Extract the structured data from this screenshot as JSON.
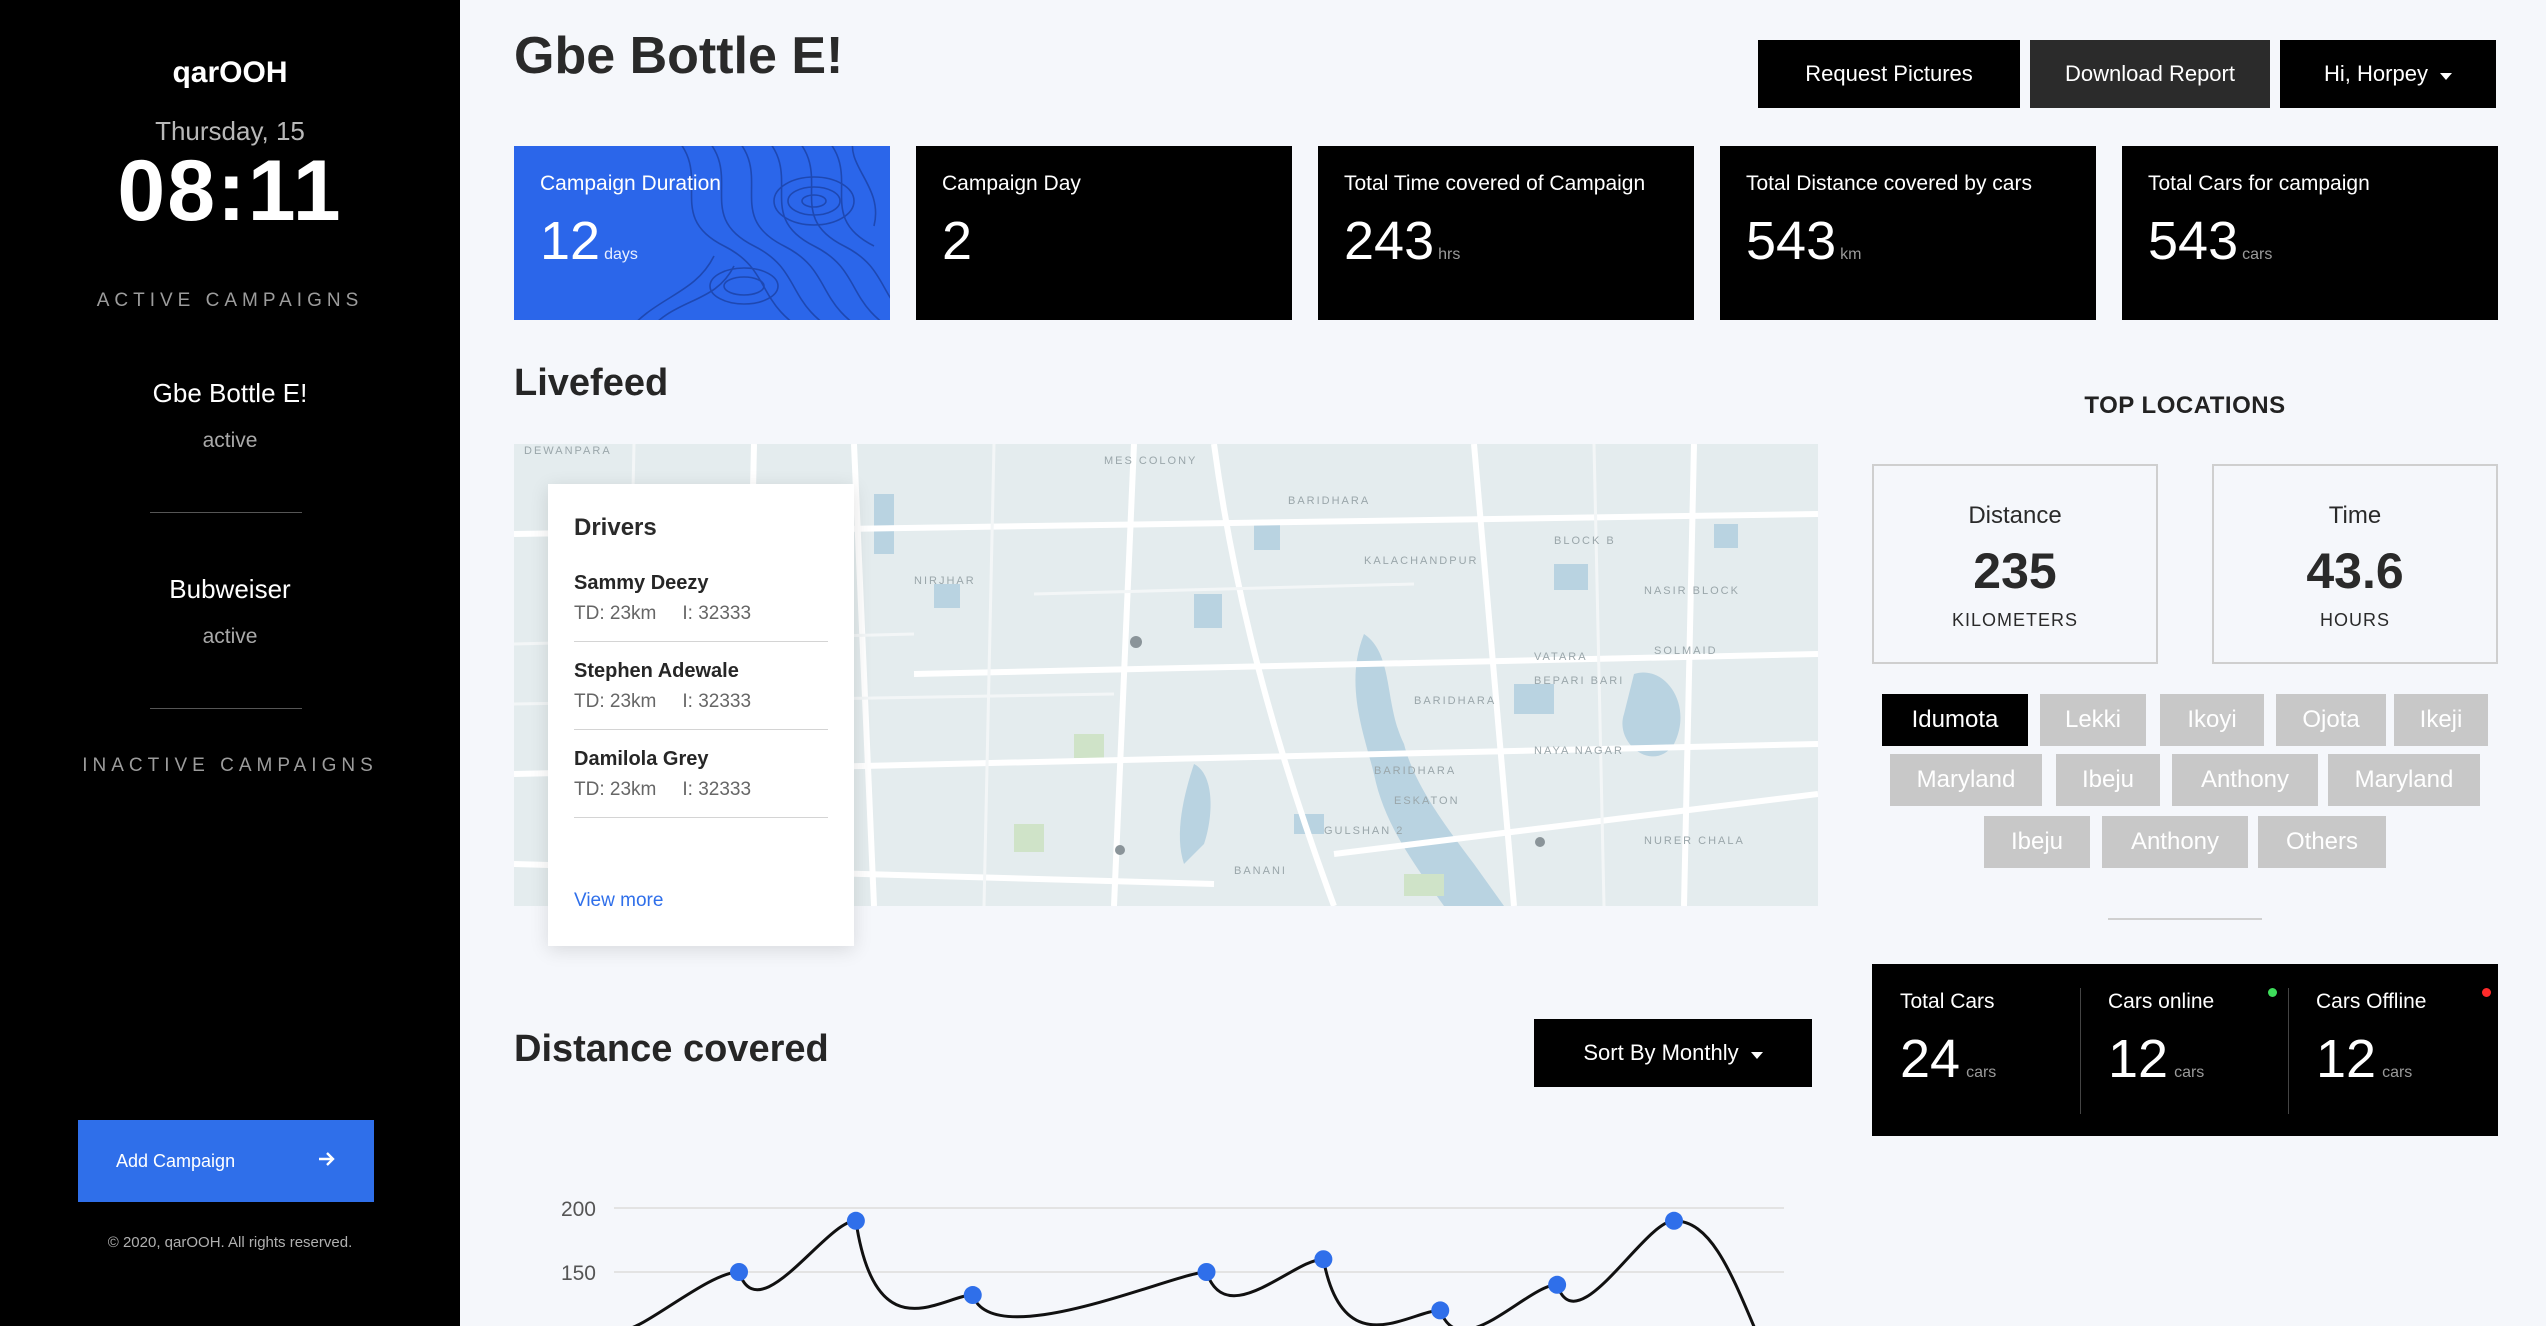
{
  "sidebar": {
    "brand": "qarOOH",
    "date": "Thursday, 15",
    "time": "08:11",
    "active_label": "ACTIVE CAMPAIGNS",
    "active_campaigns": [
      {
        "name": "Gbe Bottle E!",
        "status": "active"
      },
      {
        "name": "Bubweiser",
        "status": "active"
      }
    ],
    "inactive_label": "INACTIVE CAMPAIGNS",
    "add_button": "Add Campaign",
    "copyright": "© 2020, qarOOH. All rights reserved."
  },
  "header": {
    "title": "Gbe Bottle E!",
    "request_pictures": "Request Pictures",
    "download_report": "Download Report",
    "user_menu": "Hi, Horpey"
  },
  "stats": [
    {
      "label": "Campaign Duration",
      "value": "12",
      "unit": "days"
    },
    {
      "label": "Campaign Day",
      "value": "2",
      "unit": ""
    },
    {
      "label": "Total Time covered of Campaign",
      "value": "243",
      "unit": "hrs"
    },
    {
      "label": "Total Distance covered by cars",
      "value": "543",
      "unit": "km"
    },
    {
      "label": "Total Cars for campaign",
      "value": "543",
      "unit": "cars"
    }
  ],
  "livefeed": {
    "title": "Livefeed",
    "drivers_title": "Drivers",
    "drivers": [
      {
        "name": "Sammy Deezy",
        "td": "TD: 23km",
        "i": "I: 32333"
      },
      {
        "name": "Stephen Adewale",
        "td": "TD: 23km",
        "i": "I: 32333"
      },
      {
        "name": "Damilola Grey",
        "td": "TD: 23km",
        "i": "I: 32333"
      }
    ],
    "view_more": "View more"
  },
  "top_locations": {
    "title": "TOP LOCATIONS",
    "distance": {
      "label": "Distance",
      "value": "235",
      "unit": "KILOMETERS"
    },
    "time": {
      "label": "Time",
      "value": "43.6",
      "unit": "HOURS"
    },
    "chips": [
      "Idumota",
      "Lekki",
      "Ikoyi",
      "Ojota",
      "Ikeji",
      "Maryland",
      "Ibeju",
      "Anthony",
      "Maryland",
      "Ibeju",
      "Anthony",
      "Others"
    ],
    "active_chip": "Idumota"
  },
  "cars": {
    "total": {
      "label": "Total Cars",
      "value": "24",
      "unit": "cars"
    },
    "online": {
      "label": "Cars online",
      "value": "12",
      "unit": "cars",
      "dot_color": "#3ddc5a"
    },
    "offline": {
      "label": "Cars Offline",
      "value": "12",
      "unit": "cars",
      "dot_color": "#ff2a2a"
    }
  },
  "distance_section": {
    "title": "Distance covered",
    "sort_label": "Sort By Monthly"
  },
  "chart_data": {
    "type": "line",
    "title": "",
    "xlabel": "",
    "ylabel": "",
    "y_ticks": [
      "200",
      "150"
    ],
    "ylim": [
      100,
      210
    ],
    "series": [
      {
        "values": [
          150,
          190,
          132,
          null,
          150,
          160,
          120,
          140,
          190
        ]
      }
    ]
  },
  "colors": {
    "accent": "#2f6fea",
    "sidebar_bg": "#000000",
    "card_bg": "#000000",
    "chip_bg": "#c8c8c8"
  }
}
